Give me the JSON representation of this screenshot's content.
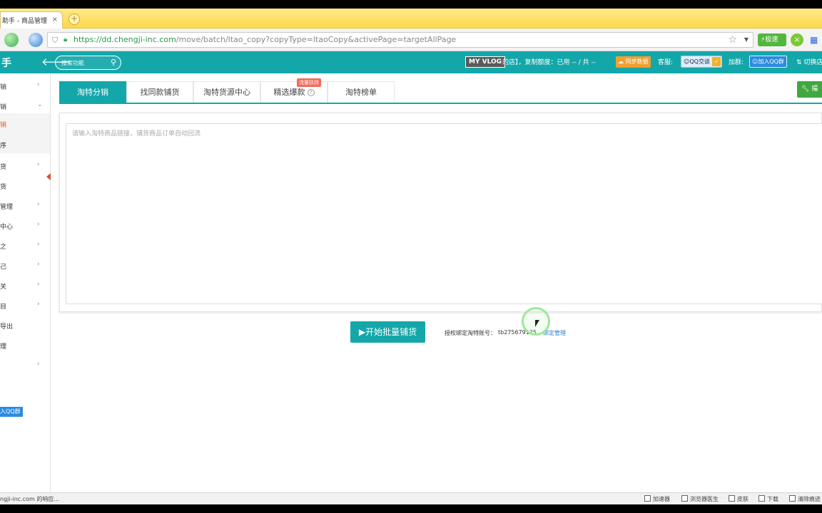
{
  "browser": {
    "tab_title": "助手 - 商品管理",
    "tab_close": "×",
    "new_tab": "+",
    "url_host": "https://dd.chengji-inc.com",
    "url_path": "/move/batch/ltao_copy?copyType=ltaoCopy&activePage=targetAllPage",
    "speed_label": "极速",
    "status_text": "ngji-inc.com 的响应...",
    "statusbar": [
      {
        "label": "加速器",
        "icon": "accelerator-icon"
      },
      {
        "label": "浏览器医生",
        "icon": "doctor-icon"
      },
      {
        "label": "皮肤",
        "icon": "skin-icon"
      },
      {
        "label": "下载",
        "icon": "download-icon"
      },
      {
        "label": "清除痕迹",
        "icon": "clean-icon"
      }
    ]
  },
  "header": {
    "logo": "手",
    "search_placeholder": "搜索功能",
    "vlog_badge": "MY VLOG",
    "quota_text": "的店】，复制额度：已用 -- / 共 --",
    "sync_label": "同步数据",
    "service_label": "客服:",
    "qq_chat": "QQ交谈",
    "group_label": "加群:",
    "join_qq": "加入QQ群",
    "switch_store": "切换店"
  },
  "sidebar": {
    "items": [
      {
        "label": "销",
        "chevron": "›"
      },
      {
        "label": "销",
        "chevron": "⌄"
      },
      {
        "label": "销",
        "chevron": ""
      },
      {
        "label": "序",
        "chevron": ""
      },
      {
        "label": "货",
        "chevron": "›"
      },
      {
        "label": "货",
        "chevron": ""
      },
      {
        "label": "管理",
        "chevron": "›"
      },
      {
        "label": "中心",
        "chevron": "›"
      },
      {
        "label": "之",
        "chevron": "›"
      },
      {
        "label": "己",
        "chevron": "›"
      },
      {
        "label": "关",
        "chevron": "›"
      },
      {
        "label": "目",
        "chevron": "›"
      },
      {
        "label": "导出",
        "chevron": ""
      },
      {
        "label": "理",
        "chevron": ""
      },
      {
        "label": "",
        "chevron": "›"
      },
      {
        "label": "",
        "chevron": ""
      }
    ],
    "join_qq": "入QQ群"
  },
  "main": {
    "tabs": [
      {
        "label": "淘特分销",
        "active": true
      },
      {
        "label": "找同款铺货",
        "active": false
      },
      {
        "label": "淘特货源中心",
        "active": false
      },
      {
        "label": "精选爆款",
        "active": false
      },
      {
        "label": "淘特榜单",
        "active": false
      }
    ],
    "promo_badge": "流量扶持",
    "help": "?",
    "tool_button": "撮",
    "textarea_placeholder": "请输入淘特商品链接，铺货商品订单自动回流",
    "start_button": "开始批量铺货",
    "bind_label": "授权绑定淘特账号：",
    "bind_account": "tb275679125",
    "bind_link": "绑定管理"
  },
  "colors": {
    "teal": "#14a7aa",
    "tabstrip": "#fcd84a",
    "link": "#2b7cd6",
    "promo": "#f26b5b"
  }
}
